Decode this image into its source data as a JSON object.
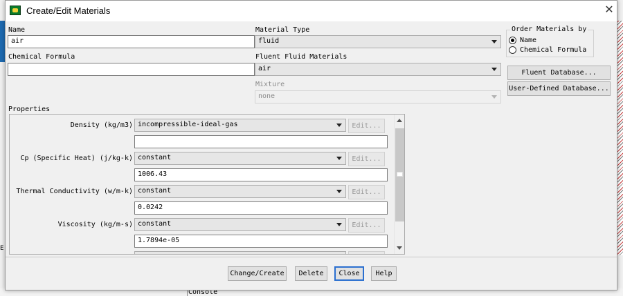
{
  "window": {
    "title": "Create/Edit Materials",
    "close_symbol": "✕"
  },
  "name": {
    "label": "Name",
    "value": "air"
  },
  "chemical_formula": {
    "label": "Chemical Formula",
    "value": ""
  },
  "material_type": {
    "label": "Material Type",
    "value": "fluid"
  },
  "fluent_fluid_materials": {
    "label": "Fluent Fluid Materials",
    "value": "air"
  },
  "mixture": {
    "label": "Mixture",
    "value": "none"
  },
  "order_by": {
    "label": "Order Materials by",
    "options": [
      {
        "label": "Name",
        "selected": true
      },
      {
        "label": "Chemical Formula",
        "selected": false
      }
    ]
  },
  "database_buttons": {
    "fluent": "Fluent Database...",
    "user_defined": "User-Defined Database..."
  },
  "properties": {
    "label": "Properties",
    "edit_label": "Edit...",
    "rows": [
      {
        "label": "Density (kg/m3)",
        "method": "incompressible-ideal-gas",
        "value": ""
      },
      {
        "label": "Cp (Specific Heat) (j/kg-k)",
        "method": "constant",
        "value": "1006.43"
      },
      {
        "label": "Thermal Conductivity (w/m-k)",
        "method": "constant",
        "value": "0.0242"
      },
      {
        "label": "Viscosity (kg/m-s)",
        "method": "constant",
        "value": "1.7894e-05"
      }
    ]
  },
  "footer": {
    "change_create": "Change/Create",
    "delete": "Delete",
    "close": "Close",
    "help": "Help"
  },
  "background": {
    "console_label": "Console",
    "left_text": "E:"
  }
}
